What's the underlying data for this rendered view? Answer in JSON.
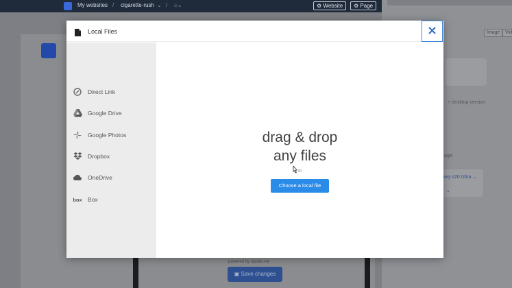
{
  "background": {
    "topbar": {
      "crumb_home": "My websites",
      "crumb_site": "cigarette-rush",
      "website_button": "Website",
      "page_button": "Page"
    },
    "canvas": {
      "powered_by": "powered by",
      "powered_brand": "wpsite.me",
      "save_button": "Save changes"
    },
    "right_panel": {
      "tab_image": "Image",
      "tab_video": "Vid",
      "note": "+ desktop version",
      "label": "age:",
      "select_value": "laxy s20 Ultra"
    }
  },
  "modal": {
    "title": "Local Files",
    "close_label": "×",
    "sidebar": {
      "items": [
        {
          "label": "Direct Link",
          "icon": "link-icon"
        },
        {
          "label": "Google Drive",
          "icon": "google-drive-icon"
        },
        {
          "label": "Google Photos",
          "icon": "google-photos-icon"
        },
        {
          "label": "Dropbox",
          "icon": "dropbox-icon"
        },
        {
          "label": "OneDrive",
          "icon": "onedrive-icon"
        },
        {
          "label": "Box",
          "icon": "box-icon"
        }
      ],
      "box_logo": "box"
    },
    "main": {
      "drag_line1": "drag & drop",
      "drag_line2": "any files",
      "or": "or",
      "choose_button": "Choose a local file"
    }
  },
  "colors": {
    "accent": "#2b8be8",
    "close_border": "#3a84d6",
    "sidebar_bg": "#ececec",
    "overlay": "#6a6c70"
  }
}
